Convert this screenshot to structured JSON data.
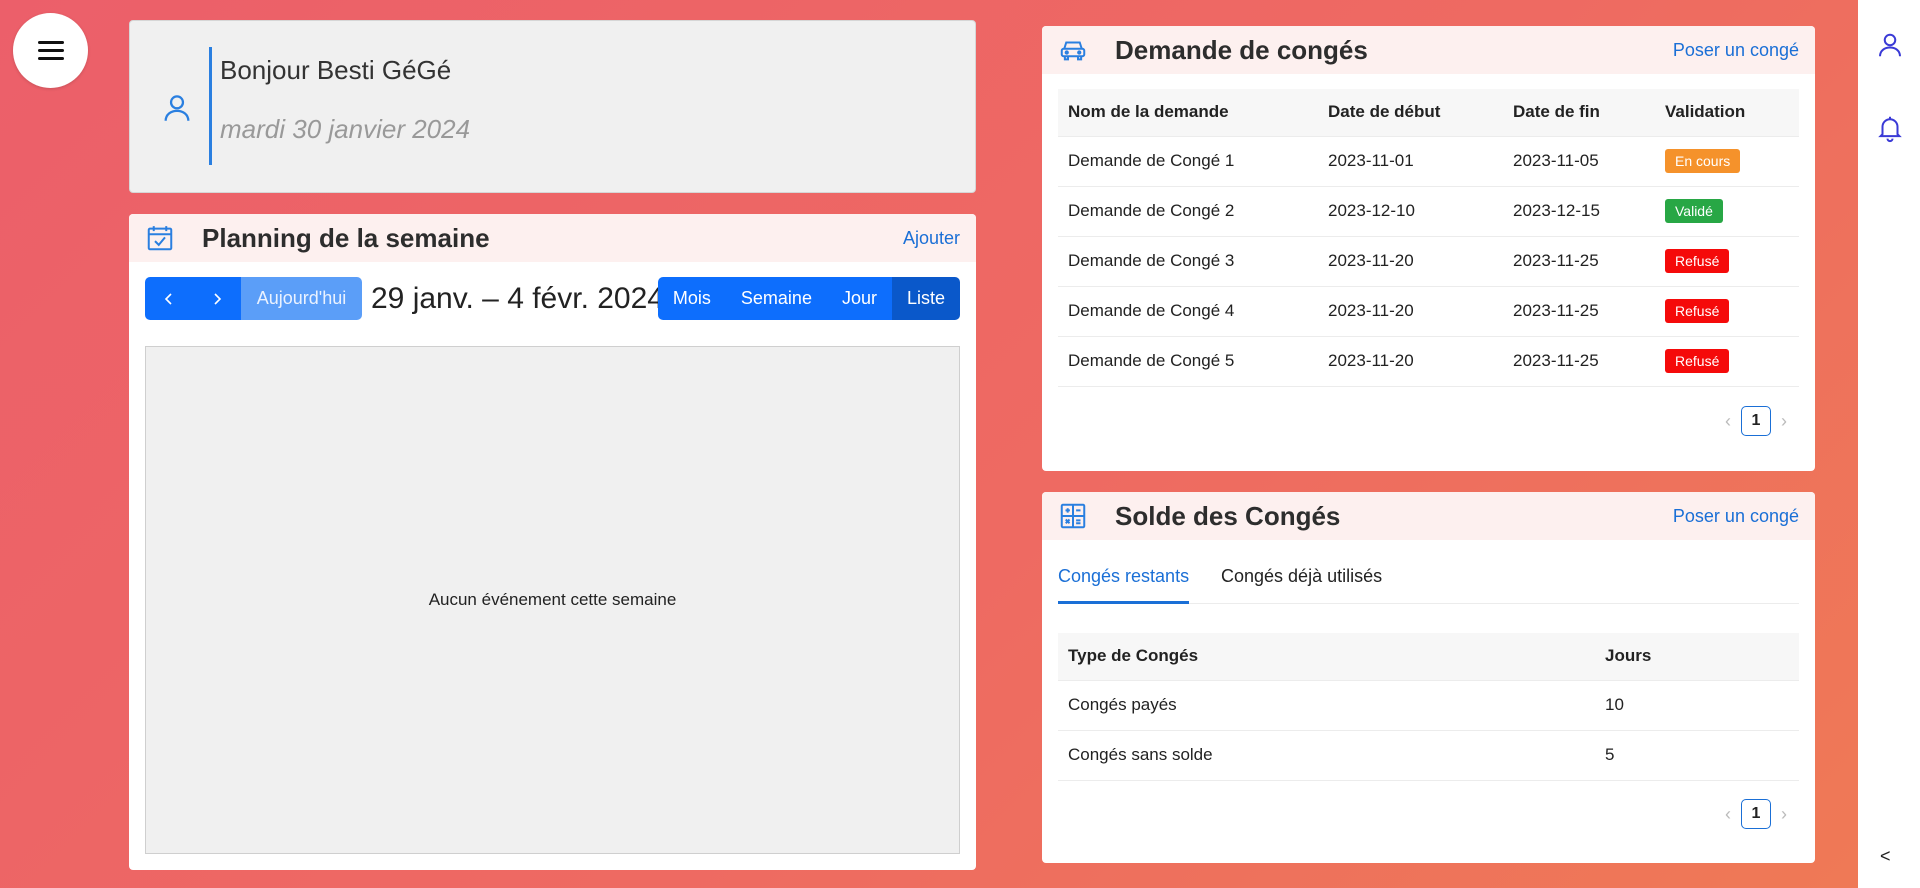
{
  "menu": {
    "icon": "hamburger-icon"
  },
  "greeting": {
    "title": "Bonjour Besti GéGé",
    "date": "mardi 30 janvier 2024",
    "icon": "user-icon"
  },
  "planning": {
    "title": "Planning de la semaine",
    "add_label": "Ajouter",
    "icon": "calendar-check-icon",
    "prev_label": "‹",
    "next_label": "›",
    "today_label": "Aujourd'hui",
    "range": "29 janv. – 4 févr. 2024",
    "views": [
      "Mois",
      "Semaine",
      "Jour",
      "Liste"
    ],
    "active_view": "Liste",
    "empty_text": "Aucun événement cette semaine"
  },
  "requests": {
    "title": "Demande de congés",
    "action_label": "Poser un congé",
    "icon": "car-icon",
    "columns": [
      "Nom de la demande",
      "Date de début",
      "Date de fin",
      "Validation"
    ],
    "rows": [
      {
        "name": "Demande de Congé 1",
        "start": "2023-11-01",
        "end": "2023-11-05",
        "status": "En cours",
        "status_color": "#f5922b"
      },
      {
        "name": "Demande de Congé 2",
        "start": "2023-12-10",
        "end": "2023-12-15",
        "status": "Validé",
        "status_color": "#28a745"
      },
      {
        "name": "Demande de Congé 3",
        "start": "2023-11-20",
        "end": "2023-11-25",
        "status": "Refusé",
        "status_color": "#f50a0a"
      },
      {
        "name": "Demande de Congé 4",
        "start": "2023-11-20",
        "end": "2023-11-25",
        "status": "Refusé",
        "status_color": "#f50a0a"
      },
      {
        "name": "Demande de Congé 5",
        "start": "2023-11-20",
        "end": "2023-11-25",
        "status": "Refusé",
        "status_color": "#f50a0a"
      }
    ],
    "page": "1"
  },
  "balance": {
    "title": "Solde des Congés",
    "action_label": "Poser un congé",
    "icon": "calculator-icon",
    "tabs": [
      "Congés restants",
      "Congés déjà utilisés"
    ],
    "active_tab": "Congés restants",
    "columns": [
      "Type de Congés",
      "Jours"
    ],
    "rows": [
      {
        "type": "Congés payés",
        "days": "10"
      },
      {
        "type": "Congés sans solde",
        "days": "5"
      }
    ],
    "page": "1"
  },
  "rail": {
    "icons": [
      "user-icon",
      "bell-icon"
    ],
    "collapse_label": "<"
  },
  "colors": {
    "accent": "#0d6efd",
    "link": "#1a6fd6",
    "rail_icon": "#3a3ad6"
  }
}
